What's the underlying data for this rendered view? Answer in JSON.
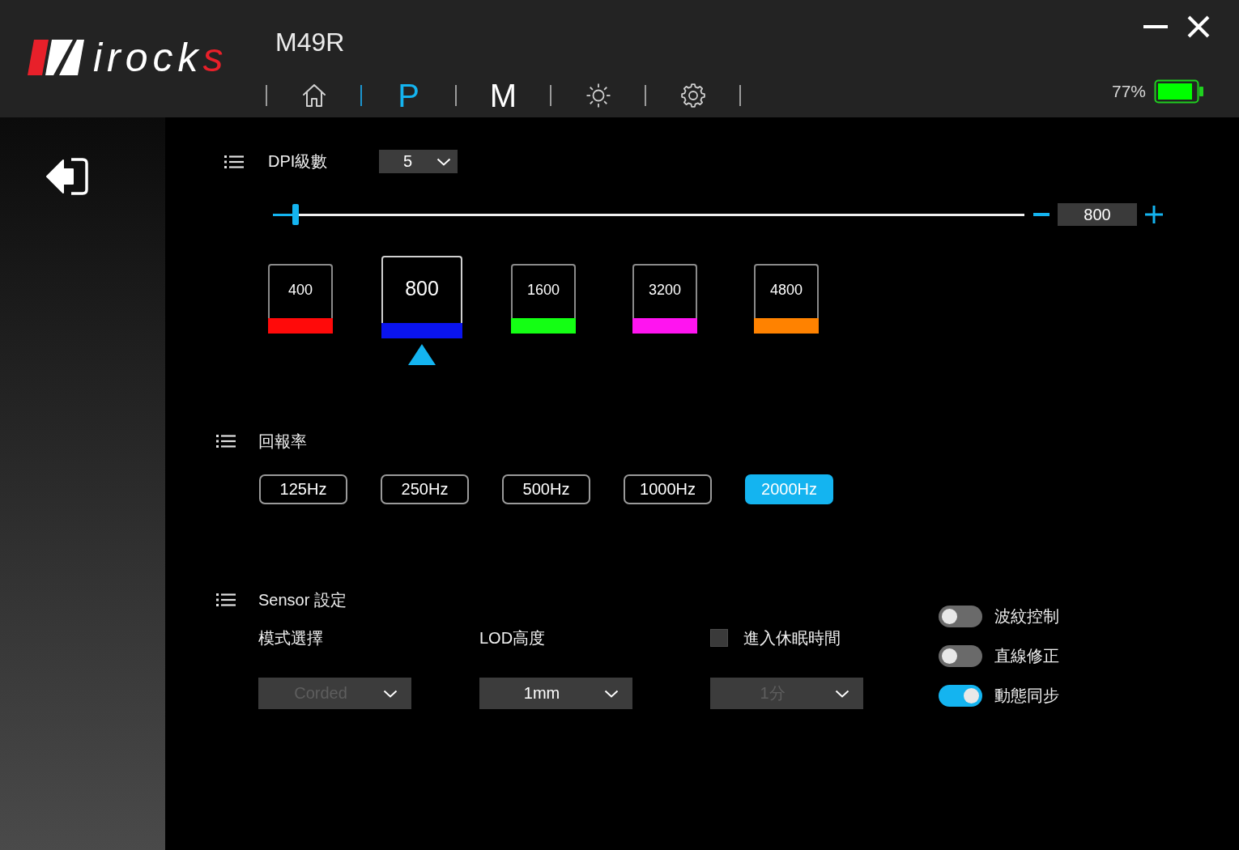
{
  "window": {
    "logo": [
      {
        "text": "irock",
        "color": "#ffffff"
      },
      {
        "text": "s",
        "color": "#e8202a"
      }
    ],
    "title": "M49R"
  },
  "nav": {
    "tabs": [
      {
        "kind": "home",
        "selected": false
      },
      {
        "kind": "letter",
        "label": "P",
        "selected": true
      },
      {
        "kind": "letter",
        "label": "M",
        "selected": false
      },
      {
        "kind": "lighting",
        "selected": false
      },
      {
        "kind": "settings",
        "selected": false
      }
    ]
  },
  "battery": {
    "reading": "77%"
  },
  "dpi": {
    "title": "DPI級數",
    "stage_count": "5",
    "slider": {
      "level": 0.03
    },
    "value": "800",
    "stages": [
      {
        "value": "400",
        "color": "#ff0a0a",
        "selected": false
      },
      {
        "value": "800",
        "color": "#0a14f0",
        "selected": true
      },
      {
        "value": "1600",
        "color": "#14ff14",
        "selected": false
      },
      {
        "value": "3200",
        "color": "#ff14f0",
        "selected": false
      },
      {
        "value": "4800",
        "color": "#ff8200",
        "selected": false
      }
    ]
  },
  "report_rate": {
    "title": "回報率",
    "options": [
      {
        "label": "125Hz",
        "selected": false
      },
      {
        "label": "250Hz",
        "selected": false
      },
      {
        "label": "500Hz",
        "selected": false
      },
      {
        "label": "1000Hz",
        "selected": false
      },
      {
        "label": "2000Hz",
        "selected": true
      }
    ]
  },
  "sensor": {
    "title": "Sensor 設定",
    "mode": {
      "label": "模式選擇",
      "value": "Corded",
      "disabled": true
    },
    "lod": {
      "label": "LOD高度",
      "value": "1mm",
      "disabled": false
    },
    "sleep": {
      "label": "進入休眠時間",
      "checked": false,
      "value": "1分",
      "disabled": true
    },
    "toggles": [
      {
        "label": "波紋控制",
        "on": false
      },
      {
        "label": "直線修正",
        "on": false
      },
      {
        "label": "動態同步",
        "on": true
      }
    ]
  }
}
